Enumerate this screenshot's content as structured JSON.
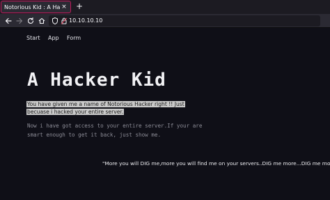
{
  "browser": {
    "tab_title": "Notorious Kid : A Hacker",
    "tab_close_glyph": "×",
    "new_tab_glyph": "+",
    "url": "10.10.10.10",
    "accent_color": "#c2185b"
  },
  "icons": {
    "back": "back-arrow-icon",
    "forward": "forward-arrow-icon",
    "reload": "reload-icon",
    "home": "home-icon",
    "shield": "shield-icon",
    "page_info": "page-info-icon"
  },
  "nav": {
    "links": [
      "Start",
      "App",
      "Form"
    ]
  },
  "main": {
    "heading": "A Hacker Kid",
    "selected_paragraph": "You have given me a name of Notorious Hacker right !! Just becuase i hacked your entire server.",
    "mono_paragraph": "Now i have got access to your entire server.If your are smart enough to get it back, just show me.",
    "quote": "\"More you will DIG me,more you will find me on your servers..DIG me more...DIG me more\""
  }
}
